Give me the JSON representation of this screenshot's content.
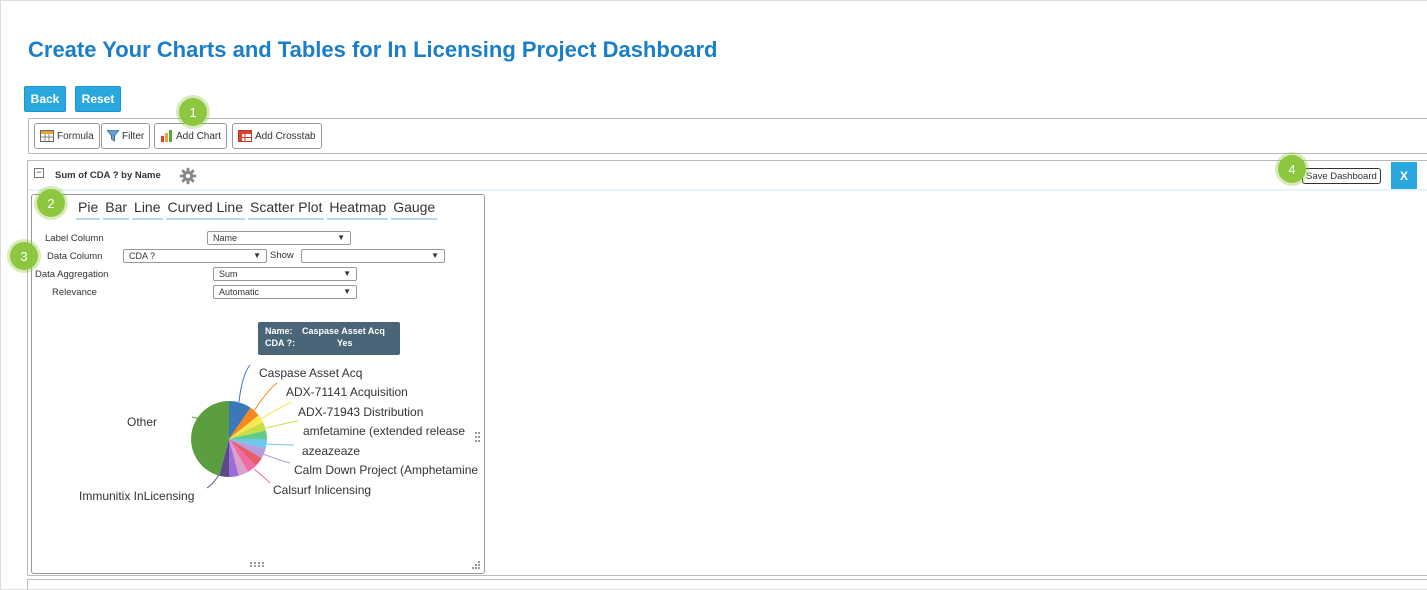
{
  "page_title": "Create Your Charts and Tables for In Licensing Project Dashboard",
  "buttons": {
    "back": "Back",
    "reset": "Reset"
  },
  "toolbar": {
    "formula": "Formula",
    "filter": "Filter",
    "add_chart": "Add Chart",
    "add_crosstab": "Add Crosstab"
  },
  "badges": [
    "1",
    "2",
    "3",
    "4"
  ],
  "panel": {
    "collapse": "−",
    "title": "Sum of CDA ? by Name",
    "save_dashboard": "Save Dashboard",
    "close": "X"
  },
  "chart_tabs": [
    "Pie",
    "Bar",
    "Line",
    "Curved Line",
    "Scatter Plot",
    "Heatmap",
    "Gauge"
  ],
  "form": {
    "label_column": {
      "label": "Label Column",
      "value": "Name"
    },
    "data_column": {
      "label": "Data Column",
      "value": "CDA ?"
    },
    "show": {
      "label": "Show",
      "value": ""
    },
    "data_aggregation": {
      "label": "Data Aggregation",
      "value": "Sum"
    },
    "relevance": {
      "label": "Relevance",
      "value": "Automatic"
    }
  },
  "tooltip": {
    "name_key": "Name:",
    "name_value": "Caspase Asset Acq",
    "cda_key": "CDA ?:",
    "cda_value": "Yes"
  },
  "pie_labels": {
    "caspase": "Caspase Asset Acq",
    "adx141": "ADX-71141 Acquisition",
    "adx943": "ADX-71943 Distribution",
    "amfetamine": "amfetamine (extended release",
    "azeaze": "azeazeaze",
    "calm": "Calm Down Project (Amphetamine",
    "calsurf": "Calsurf Inlicensing",
    "immunitix": "Immunitix InLicensing",
    "other": "Other"
  },
  "colors": {
    "accent": "#29a8e0",
    "title": "#1a7ec8",
    "badge": "#8dc63f",
    "tooltip": "#4a6478"
  }
}
